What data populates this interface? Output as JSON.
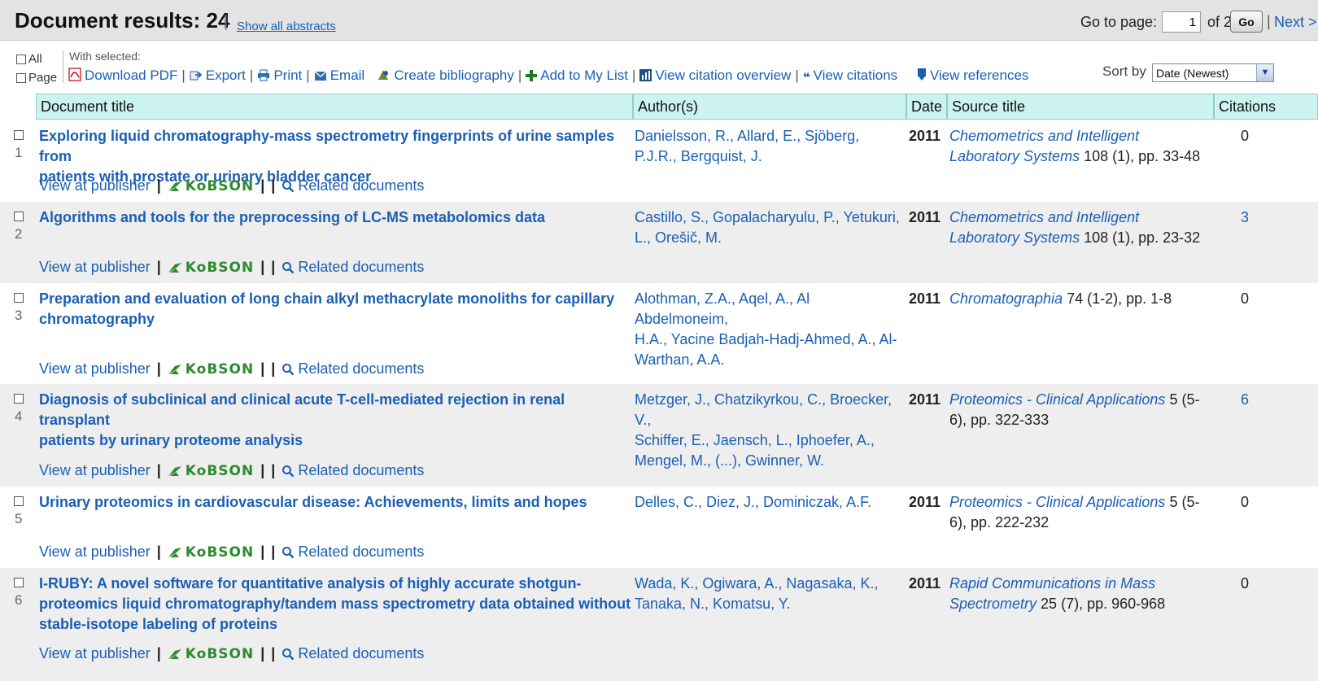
{
  "header": {
    "title": "Document results: 24",
    "separator": "|",
    "show_abstracts": "Show all abstracts",
    "goto_label": "Go to page:",
    "page_value": "1",
    "of_label": "of 2",
    "go_label": "Go",
    "next_sep": "|",
    "next_label": "Next >"
  },
  "toolbar": {
    "all_label": "All",
    "page_label": "Page",
    "with_selected": "With selected:",
    "download_pdf": "Download PDF",
    "export": "Export",
    "print": "Print",
    "email": "Email",
    "create_bibliography": "Create bibliography",
    "add_to_list": "Add to My List",
    "view_citation_overview": "View citation overview",
    "view_citations": "View citations",
    "view_references": "View references",
    "pipe": "|",
    "sort_by_label": "Sort by",
    "sort_value": "Date (Newest)",
    "sort_arrow": "▼"
  },
  "columns": {
    "title": "Document title",
    "authors": "Author(s)",
    "date": "Date",
    "source": "Source title",
    "citations": "Citations"
  },
  "row_links": {
    "view_at_publisher": "View at publisher",
    "pipe": "|",
    "kobson": "KoBSON",
    "related": "Related documents"
  },
  "results": [
    {
      "num": "1",
      "title_lines": [
        "Exploring liquid chromatography-mass spectrometry fingerprints of urine samples from",
        "patients with prostate or urinary bladder cancer"
      ],
      "author_lines": [
        "Danielsson, R., Allard, E., Sjöberg,",
        "P.J.R., Bergquist, J."
      ],
      "year": "2011",
      "journal_a": "Chemometrics and Intelligent",
      "journal_b": "Laboratory Systems",
      "volume_b": " 108 (1), pp. 33-48",
      "citations": "0"
    },
    {
      "num": "2",
      "title_lines": [
        "Algorithms and tools for the preprocessing of LC-MS metabolomics data"
      ],
      "author_lines": [
        "Castillo, S., Gopalacharyulu, P., Yetukuri,",
        "L., Orešič, M."
      ],
      "year": "2011",
      "journal_a": "Chemometrics and Intelligent",
      "journal_b": "Laboratory Systems",
      "volume_b": " 108 (1), pp. 23-32",
      "citations": "3"
    },
    {
      "num": "3",
      "title_lines": [
        "Preparation and evaluation of long chain alkyl methacrylate monoliths for capillary",
        "chromatography"
      ],
      "author_lines": [
        "Alothman, Z.A., Aqel, A., Al Abdelmoneim,",
        "H.A., Yacine Badjah-Hadj-Ahmed, A., Al-",
        "Warthan, A.A."
      ],
      "year": "2011",
      "journal_a": "Chromatographia",
      "volume_a": " 74 (1-2), pp. 1-8",
      "citations": "0"
    },
    {
      "num": "4",
      "title_lines": [
        "Diagnosis of subclinical and clinical acute T-cell-mediated rejection in renal transplant",
        "patients by urinary proteome analysis"
      ],
      "author_lines": [
        "Metzger, J., Chatzikyrkou, C., Broecker, V.,",
        "Schiffer, E., Jaensch, L., Iphoefer, A.,",
        "Mengel, M., (...), Gwinner, W."
      ],
      "year": "2011",
      "journal_a": "Proteomics - Clinical Applications",
      "volume_a": " 5 (5-",
      "volume_b": "6), pp. 322-333",
      "citations": "6"
    },
    {
      "num": "5",
      "title_lines": [
        "Urinary proteomics in cardiovascular disease: Achievements, limits and hopes"
      ],
      "author_lines": [
        "Delles, C., Diez, J., Dominiczak, A.F."
      ],
      "year": "2011",
      "journal_a": "Proteomics - Clinical Applications",
      "volume_a": " 5 (5-",
      "volume_b": "6), pp. 222-232",
      "citations": "0"
    },
    {
      "num": "6",
      "title_lines": [
        "I-RUBY: A novel software for quantitative analysis of highly accurate shotgun-",
        "proteomics liquid chromatography/tandem mass spectrometry data obtained without",
        "stable-isotope labeling of proteins"
      ],
      "author_lines": [
        "Wada, K., Ogiwara, A., Nagasaka, K.,",
        "Tanaka, N., Komatsu, Y."
      ],
      "year": "2011",
      "journal_a": "Rapid Communications in Mass",
      "journal_b": "Spectrometry",
      "volume_b": " 25 (7), pp. 960-968",
      "citations": "0"
    }
  ]
}
